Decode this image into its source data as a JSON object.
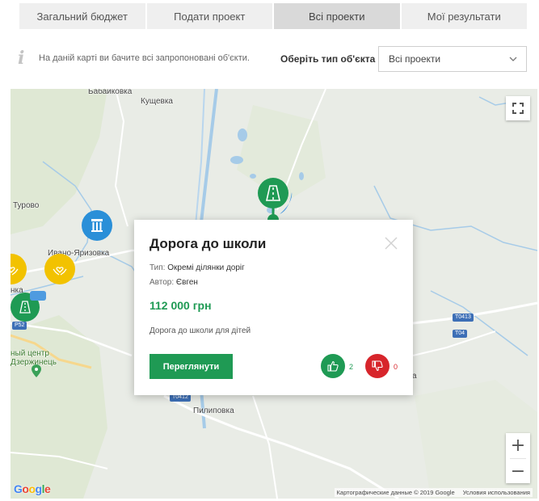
{
  "tabs": [
    {
      "label": "Загальний бюджет",
      "active": false
    },
    {
      "label": "Подати проект",
      "active": false
    },
    {
      "label": "Всі проекти",
      "active": true
    },
    {
      "label": "Мої результати",
      "active": false
    }
  ],
  "info": {
    "icon": "info-icon",
    "text": "На даній карті ви бачите всі запропоновані об'єкти."
  },
  "filter": {
    "label": "Оберіть тип об'єкта",
    "selected": "Всі проекти"
  },
  "map": {
    "places": {
      "babaykovka": "Бабайковка",
      "kushchevka": "Кущевка",
      "turovo": "Турово",
      "ivano_yaryzovka": "Ивано-Яризовка",
      "nka": "нка",
      "center": "ный центр",
      "dzerzhynets": "Дзержинець",
      "pylypivka": "Пилиповка",
      "a": "а"
    },
    "roads": {
      "p52": "P52",
      "t0412": "T0412",
      "t0413": "T0413",
      "t04": "T04"
    },
    "attribution": "Картографические данные © 2019 Google",
    "terms": "Условия использования",
    "google": "Google",
    "zoom_in": "+",
    "zoom_out": "−"
  },
  "popup": {
    "title": "Дорога до школи",
    "type_label": "Тип:",
    "type_value": "Окремі ділянки доріг",
    "author_label": "Автор:",
    "author_value": "Євген",
    "price": "112 000 грн",
    "description": "Дорога до школи для дітей",
    "button": "Переглянути",
    "likes": "2",
    "dislikes": "0"
  },
  "colors": {
    "accent_green": "#1f9a54",
    "dislike_red": "#d7252b",
    "marker_blue": "#2a8fd8",
    "marker_yellow": "#f2c200"
  }
}
